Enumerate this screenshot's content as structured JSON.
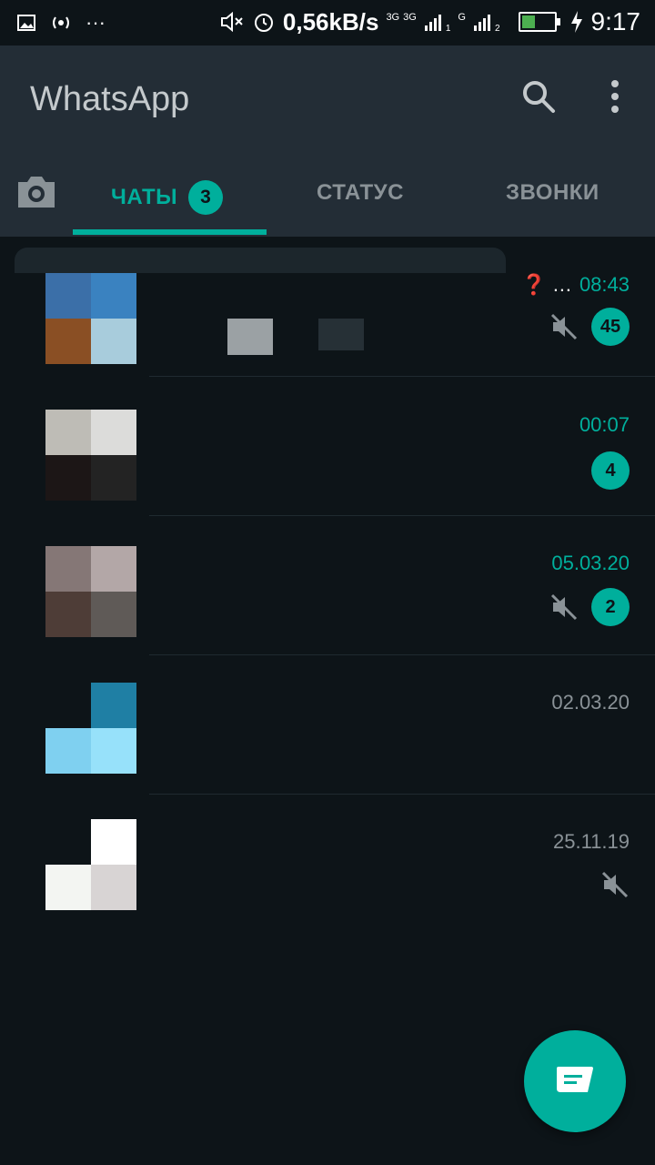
{
  "status_bar": {
    "speed": "0,56kB/s",
    "time": "9:17",
    "net1": "3G",
    "net2": "3G",
    "net3": "G",
    "sim1": "1",
    "sim2": "2"
  },
  "app_bar": {
    "title": "WhatsApp",
    "search_icon": "search-icon",
    "menu_icon": "more-vert-icon"
  },
  "tabs": {
    "camera_icon": "camera-icon",
    "chats_label": "ЧАТЫ",
    "chats_badge": "3",
    "status_label": "СТАТУС",
    "calls_label": "ЗВОНКИ"
  },
  "chats": [
    {
      "time": "08:43",
      "unread": "45",
      "muted": true,
      "time_highlighted": true,
      "prefix": "❓ …"
    },
    {
      "time": "00:07",
      "unread": "4",
      "muted": false,
      "time_highlighted": true
    },
    {
      "time": "05.03.20",
      "unread": "2",
      "muted": true,
      "time_highlighted": true
    },
    {
      "time": "02.03.20",
      "unread": "",
      "muted": false,
      "time_highlighted": false
    },
    {
      "time": "25.11.19",
      "unread": "",
      "muted": true,
      "time_highlighted": false
    }
  ],
  "colors": {
    "accent": "#00af9c",
    "appbar": "#232d36",
    "background": "#0d1418"
  },
  "fab_icon": "new-chat-icon"
}
